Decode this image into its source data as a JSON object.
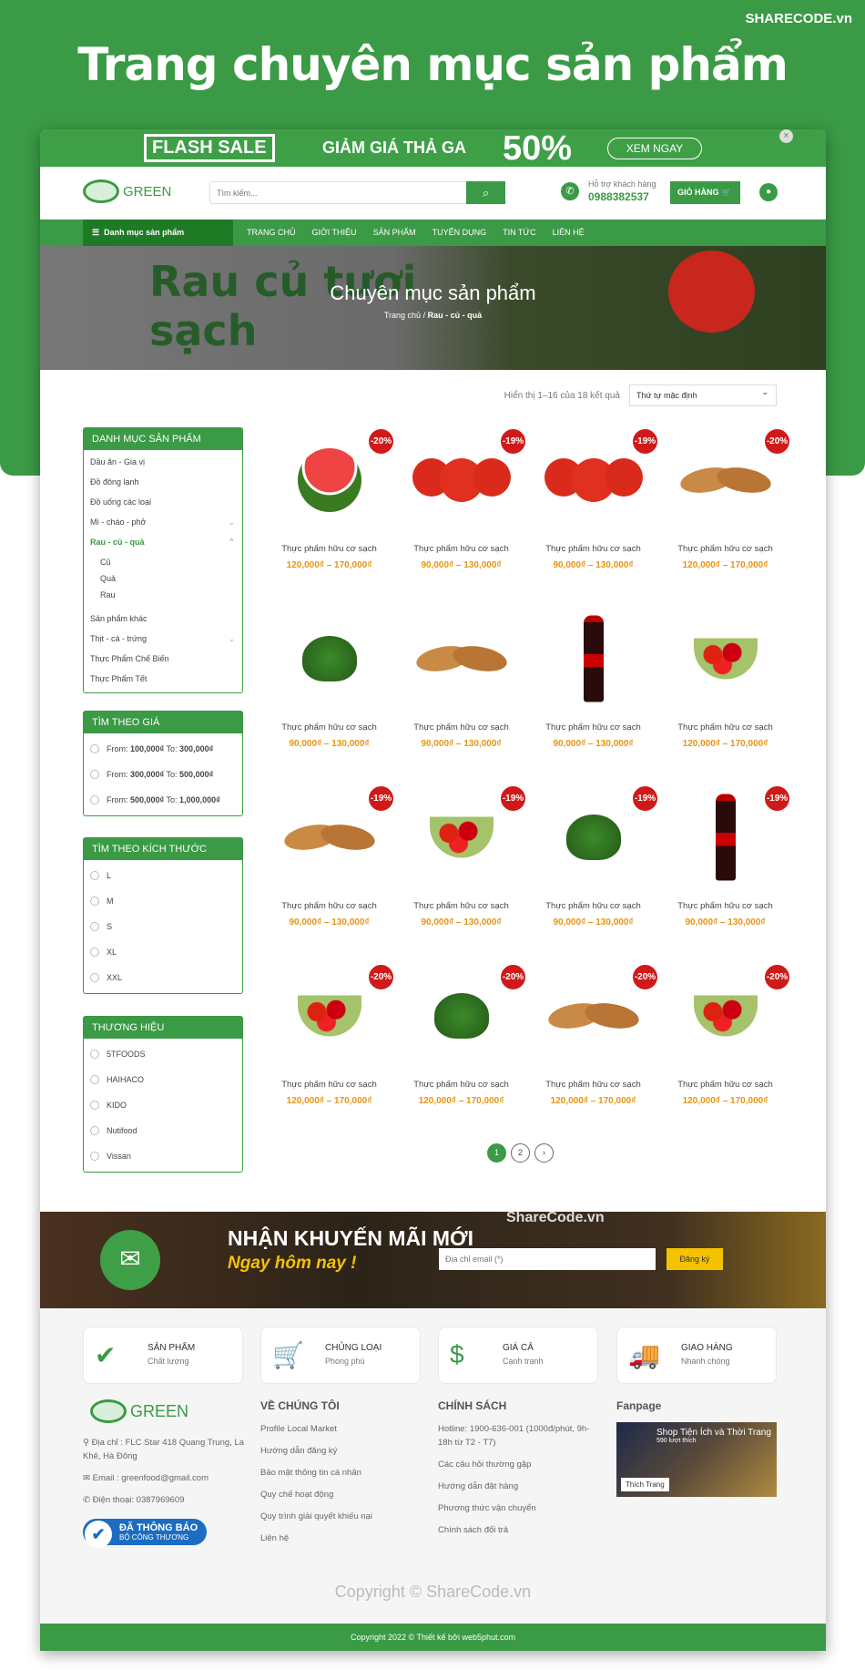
{
  "headline": "Trang chuyên mục sản phẩm",
  "brand": "SHARECODE.vn",
  "flash": {
    "box": "FLASH SALE",
    "text": "GIẢM GIÁ THẢ GA",
    "percent": "50%",
    "button": "XEM NGAY",
    "close": "×"
  },
  "header": {
    "logo": "GREEN",
    "search_placeholder": "Tìm kiếm...",
    "support_label": "Hỗ trợ khách hàng",
    "phone": "0988382537",
    "cart": "GIỎ HÀNG"
  },
  "nav": {
    "category": "Danh mục sản phẩm",
    "items": [
      "TRANG CHỦ",
      "GIỚI THIỆU",
      "SẢN PHẨM",
      "TUYỂN DỤNG",
      "TIN TỨC",
      "LIÊN HỆ"
    ]
  },
  "hero": {
    "deco": "Rau củ tươi sạch",
    "title": "Chuyên mục sản phẩm",
    "breadcrumb_home": "Trang chủ",
    "breadcrumb_current": "Rau - củ - quả"
  },
  "sort": {
    "result": "Hiển thị 1–16 của 18 kết quả",
    "selected": "Thứ tự mặc định"
  },
  "sidebar": {
    "categories_title": "DANH MỤC SẢN PHẨM",
    "categories": [
      "Dầu ăn - Gia vị",
      "Đồ đông lạnh",
      "Đồ uống các loại",
      "Mì - cháo - phở",
      "Rau - củ - quả",
      "Củ",
      "Quả",
      "Rau",
      "Sản phẩm khác",
      "Thịt - cá - trứng",
      "Thực Phẩm Chế Biến",
      "Thực Phẩm Tết"
    ],
    "price_title": "TÌM THEO GIÁ",
    "prices": [
      {
        "from": "100,000₫",
        "to": "300,000₫"
      },
      {
        "from": "300,000₫",
        "to": "500,000₫"
      },
      {
        "from": "500,000₫",
        "to": "1,000,000₫"
      }
    ],
    "price_from": "From:",
    "price_to": "To:",
    "size_title": "TÌM THEO KÍCH THƯỚC",
    "sizes": [
      "L",
      "M",
      "S",
      "XL",
      "XXL"
    ],
    "brand_title": "THƯƠNG HIỆU",
    "brands": [
      "5TFOODS",
      "HAIHACO",
      "KIDO",
      "Nutifood",
      "Vissan"
    ]
  },
  "products": [
    {
      "badge": "-20%",
      "img": "watermelon",
      "name": "Thực phẩm hữu cơ sạch",
      "price": "120,000₫ – 170,000₫"
    },
    {
      "badge": "-19%",
      "img": "tomato",
      "name": "Thực phẩm hữu cơ sạch",
      "price": "90,000₫ – 130,000₫"
    },
    {
      "badge": "-19%",
      "img": "tomato",
      "name": "Thực phẩm hữu cơ sạch",
      "price": "90,000₫ – 130,000₫"
    },
    {
      "badge": "-20%",
      "img": "bread",
      "name": "Thực phẩm hữu cơ sạch",
      "price": "120,000₫ – 170,000₫"
    },
    {
      "badge": "",
      "img": "broccoli",
      "name": "Thực phẩm hữu cơ sạch",
      "price": "90,000₫ – 130,000₫"
    },
    {
      "badge": "",
      "img": "bread",
      "name": "Thực phẩm hữu cơ sạch",
      "price": "90,000₫ – 130,000₫"
    },
    {
      "badge": "",
      "img": "cola",
      "name": "Thực phẩm hữu cơ sạch",
      "price": "90,000₫ – 130,000₫"
    },
    {
      "badge": "",
      "img": "cherries",
      "name": "Thực phẩm hữu cơ sạch",
      "price": "120,000₫ – 170,000₫"
    },
    {
      "badge": "-19%",
      "img": "bread",
      "name": "Thực phẩm hữu cơ sạch",
      "price": "90,000₫ – 130,000₫"
    },
    {
      "badge": "-19%",
      "img": "cherries",
      "name": "Thực phẩm hữu cơ sạch",
      "price": "90,000₫ – 130,000₫"
    },
    {
      "badge": "-19%",
      "img": "broccoli",
      "name": "Thực phẩm hữu cơ sạch",
      "price": "90,000₫ – 130,000₫"
    },
    {
      "badge": "-19%",
      "img": "cola",
      "name": "Thực phẩm hữu cơ sạch",
      "price": "90,000₫ – 130,000₫"
    },
    {
      "badge": "-20%",
      "img": "cherries",
      "name": "Thực phẩm hữu cơ sạch",
      "price": "120,000₫ – 170,000₫"
    },
    {
      "badge": "-20%",
      "img": "broccoli",
      "name": "Thực phẩm hữu cơ sạch",
      "price": "120,000₫ – 170,000₫"
    },
    {
      "badge": "-20%",
      "img": "bread",
      "name": "Thực phẩm hữu cơ sạch",
      "price": "120,000₫ – 170,000₫"
    },
    {
      "badge": "-20%",
      "img": "cherries",
      "name": "Thực phẩm hữu cơ sạch",
      "price": "120,000₫ – 170,000₫"
    }
  ],
  "pagination": {
    "pages": [
      "1",
      "2"
    ],
    "next": "›"
  },
  "newsletter": {
    "title": "NHẬN KHUYẾN MÃI MỚI",
    "subtitle": "Ngay hôm nay !",
    "placeholder": "Địa chỉ email (*)",
    "button": "Đăng ký",
    "watermark": "ShareCode.vn"
  },
  "features": [
    {
      "title": "SẢN PHẨM",
      "sub": "Chất lượng",
      "icon": "check-icon"
    },
    {
      "title": "CHỦNG LOẠI",
      "sub": "Phong phú",
      "icon": "cart-icon"
    },
    {
      "title": "GIÁ CẢ",
      "sub": "Cạnh tranh",
      "icon": "money-icon"
    },
    {
      "title": "GIAO HÀNG",
      "sub": "Nhanh chóng",
      "icon": "truck-icon"
    }
  ],
  "footer": {
    "logo": "GREEN",
    "address": "Địa chỉ : FLC Star 418 Quang Trung, La Khê, Hà Đông",
    "email": "Email : greenfood@gmail.com",
    "phone": "Điện thoại: 0387969609",
    "badge_title": "ĐÃ THÔNG BÁO",
    "badge_sub": "BỘ CÔNG THƯƠNG",
    "about_title": "VỀ CHÚNG TÔI",
    "about": [
      "Profile Local Market",
      "Hướng dẫn đăng ký",
      "Bảo mật thông tin cá nhân",
      "Quy chế hoạt động",
      "Quy trình giải quyết khiếu nại",
      "Liên hệ"
    ],
    "policy_title": "CHÍNH SÁCH",
    "policy": [
      "Hotline: 1900-636-001 (1000đ/phút, 9h-18h từ T2 - T7)",
      "Các câu hỏi thường gặp",
      "Hướng dẫn đặt hàng",
      "Phương thức vận chuyển",
      "Chính sách đổi trả"
    ],
    "fanpage_title": "Fanpage",
    "fanpage_name": "Shop Tiện Ích và Thời Trang",
    "fanpage_likes": "590 lượt thích",
    "fanpage_like_btn": "Thích Trang",
    "watermark": "Copyright © ShareCode.vn",
    "copyright": "Copyright 2022 © Thiết kế bởi web5phut.com"
  }
}
